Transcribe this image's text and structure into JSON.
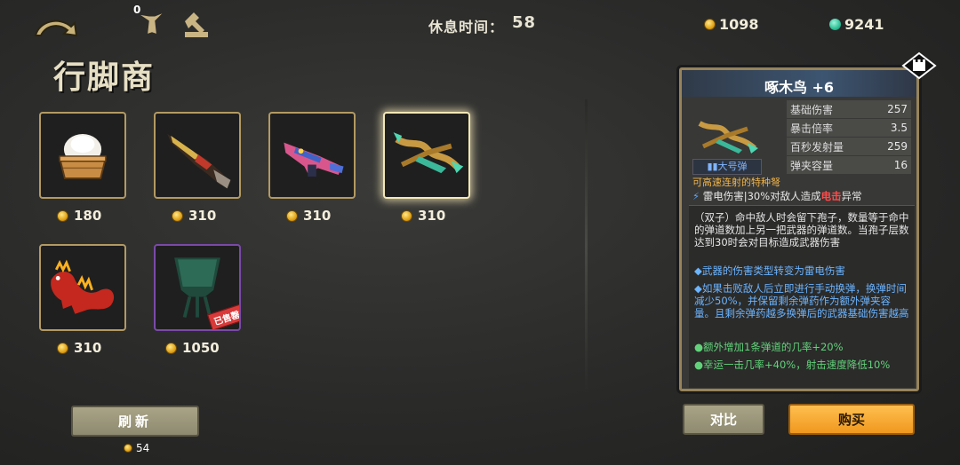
{
  "top": {
    "item_count": "0",
    "rest_label": "休息时间：",
    "rest_value": "58",
    "gold": "1098",
    "gems": "9241"
  },
  "shop": {
    "title": "行脚商",
    "items": [
      {
        "icon": "bread-basket",
        "price": "180"
      },
      {
        "icon": "golden-rifle",
        "price": "310"
      },
      {
        "icon": "pink-blaster",
        "price": "310"
      },
      {
        "icon": "woodpecker-crossbow",
        "price": "310",
        "selected": true
      },
      {
        "icon": "red-lizard-pet",
        "price": "310"
      },
      {
        "icon": "bronze-goblet",
        "price": "1050",
        "tag": "已售罄"
      }
    ],
    "refresh_label": "刷新",
    "refresh_cost": "54"
  },
  "detail": {
    "name": "啄木鸟 +6",
    "ammo": "大号弹",
    "stats": [
      {
        "label": "基础伤害",
        "value": "257"
      },
      {
        "label": "暴击倍率",
        "value": "3.5"
      },
      {
        "label": "百秒发射量",
        "value": "259"
      },
      {
        "label": "弹夹容量",
        "value": "16"
      }
    ],
    "subtitle": "可高速连射的特种弩",
    "element_prefix": "雷电伤害",
    "element_text": "30%对敌人造成",
    "element_highlight": "电击",
    "element_suffix": "异常",
    "desc_1": "（双子）命中敌人时会留下孢子，数量等于命中的弹道数加上另一把武器的弹道数。当孢子层数达到30时会对目标造成武器伤害",
    "desc_2": "◆武器的伤害类型转变为雷电伤害",
    "desc_3": "◆如果击败敌人后立即进行手动换弹，换弹时间减少50%，并保留剩余弹药作为额外弹夹容量。且剩余弹药越多换弹后的武器基础伤害越高",
    "desc_4": "●额外增加1条弹道的几率+20%",
    "desc_5": "●幸运一击几率+40%，射击速度降低10%"
  },
  "actions": {
    "compare_label": "对比",
    "buy_label": "购买"
  },
  "colors": {
    "frame": "#b39a62",
    "gold_text": "#f3eedc",
    "buy_button": "#f7a93a",
    "highlight_red": "#ff4a4a",
    "desc_blue": "#6cb4ff",
    "desc_green": "#62d27a"
  }
}
